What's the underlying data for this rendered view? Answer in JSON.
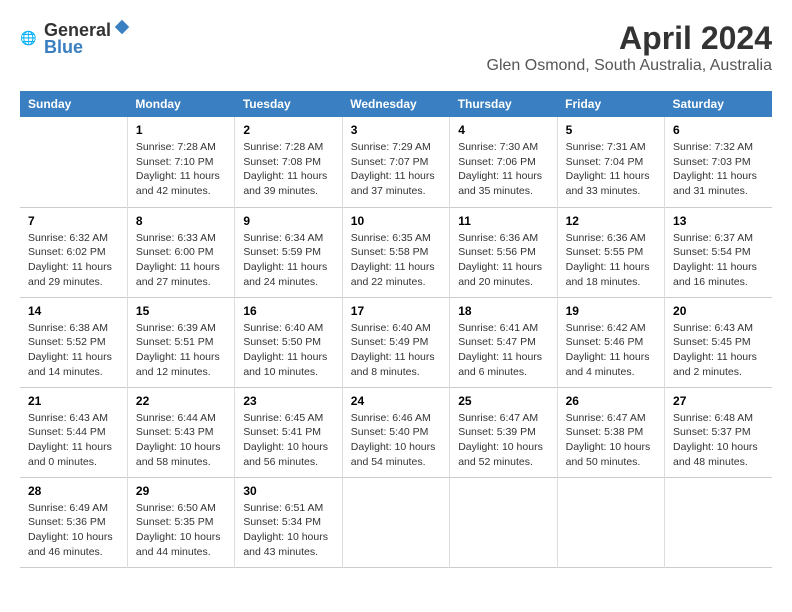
{
  "header": {
    "logo_general": "General",
    "logo_blue": "Blue",
    "month_title": "April 2024",
    "location": "Glen Osmond, South Australia, Australia"
  },
  "weekdays": [
    "Sunday",
    "Monday",
    "Tuesday",
    "Wednesday",
    "Thursday",
    "Friday",
    "Saturday"
  ],
  "weeks": [
    [
      {
        "day": "",
        "info": ""
      },
      {
        "day": "1",
        "info": "Sunrise: 7:28 AM\nSunset: 7:10 PM\nDaylight: 11 hours and 42 minutes."
      },
      {
        "day": "2",
        "info": "Sunrise: 7:28 AM\nSunset: 7:08 PM\nDaylight: 11 hours and 39 minutes."
      },
      {
        "day": "3",
        "info": "Sunrise: 7:29 AM\nSunset: 7:07 PM\nDaylight: 11 hours and 37 minutes."
      },
      {
        "day": "4",
        "info": "Sunrise: 7:30 AM\nSunset: 7:06 PM\nDaylight: 11 hours and 35 minutes."
      },
      {
        "day": "5",
        "info": "Sunrise: 7:31 AM\nSunset: 7:04 PM\nDaylight: 11 hours and 33 minutes."
      },
      {
        "day": "6",
        "info": "Sunrise: 7:32 AM\nSunset: 7:03 PM\nDaylight: 11 hours and 31 minutes."
      }
    ],
    [
      {
        "day": "7",
        "info": "Sunrise: 6:32 AM\nSunset: 6:02 PM\nDaylight: 11 hours and 29 minutes."
      },
      {
        "day": "8",
        "info": "Sunrise: 6:33 AM\nSunset: 6:00 PM\nDaylight: 11 hours and 27 minutes."
      },
      {
        "day": "9",
        "info": "Sunrise: 6:34 AM\nSunset: 5:59 PM\nDaylight: 11 hours and 24 minutes."
      },
      {
        "day": "10",
        "info": "Sunrise: 6:35 AM\nSunset: 5:58 PM\nDaylight: 11 hours and 22 minutes."
      },
      {
        "day": "11",
        "info": "Sunrise: 6:36 AM\nSunset: 5:56 PM\nDaylight: 11 hours and 20 minutes."
      },
      {
        "day": "12",
        "info": "Sunrise: 6:36 AM\nSunset: 5:55 PM\nDaylight: 11 hours and 18 minutes."
      },
      {
        "day": "13",
        "info": "Sunrise: 6:37 AM\nSunset: 5:54 PM\nDaylight: 11 hours and 16 minutes."
      }
    ],
    [
      {
        "day": "14",
        "info": "Sunrise: 6:38 AM\nSunset: 5:52 PM\nDaylight: 11 hours and 14 minutes."
      },
      {
        "day": "15",
        "info": "Sunrise: 6:39 AM\nSunset: 5:51 PM\nDaylight: 11 hours and 12 minutes."
      },
      {
        "day": "16",
        "info": "Sunrise: 6:40 AM\nSunset: 5:50 PM\nDaylight: 11 hours and 10 minutes."
      },
      {
        "day": "17",
        "info": "Sunrise: 6:40 AM\nSunset: 5:49 PM\nDaylight: 11 hours and 8 minutes."
      },
      {
        "day": "18",
        "info": "Sunrise: 6:41 AM\nSunset: 5:47 PM\nDaylight: 11 hours and 6 minutes."
      },
      {
        "day": "19",
        "info": "Sunrise: 6:42 AM\nSunset: 5:46 PM\nDaylight: 11 hours and 4 minutes."
      },
      {
        "day": "20",
        "info": "Sunrise: 6:43 AM\nSunset: 5:45 PM\nDaylight: 11 hours and 2 minutes."
      }
    ],
    [
      {
        "day": "21",
        "info": "Sunrise: 6:43 AM\nSunset: 5:44 PM\nDaylight: 11 hours and 0 minutes."
      },
      {
        "day": "22",
        "info": "Sunrise: 6:44 AM\nSunset: 5:43 PM\nDaylight: 10 hours and 58 minutes."
      },
      {
        "day": "23",
        "info": "Sunrise: 6:45 AM\nSunset: 5:41 PM\nDaylight: 10 hours and 56 minutes."
      },
      {
        "day": "24",
        "info": "Sunrise: 6:46 AM\nSunset: 5:40 PM\nDaylight: 10 hours and 54 minutes."
      },
      {
        "day": "25",
        "info": "Sunrise: 6:47 AM\nSunset: 5:39 PM\nDaylight: 10 hours and 52 minutes."
      },
      {
        "day": "26",
        "info": "Sunrise: 6:47 AM\nSunset: 5:38 PM\nDaylight: 10 hours and 50 minutes."
      },
      {
        "day": "27",
        "info": "Sunrise: 6:48 AM\nSunset: 5:37 PM\nDaylight: 10 hours and 48 minutes."
      }
    ],
    [
      {
        "day": "28",
        "info": "Sunrise: 6:49 AM\nSunset: 5:36 PM\nDaylight: 10 hours and 46 minutes."
      },
      {
        "day": "29",
        "info": "Sunrise: 6:50 AM\nSunset: 5:35 PM\nDaylight: 10 hours and 44 minutes."
      },
      {
        "day": "30",
        "info": "Sunrise: 6:51 AM\nSunset: 5:34 PM\nDaylight: 10 hours and 43 minutes."
      },
      {
        "day": "",
        "info": ""
      },
      {
        "day": "",
        "info": ""
      },
      {
        "day": "",
        "info": ""
      },
      {
        "day": "",
        "info": ""
      }
    ]
  ]
}
